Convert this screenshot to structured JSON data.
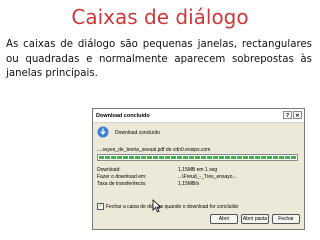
{
  "slide": {
    "title": "Caixas de diálogo",
    "body": "As caixas de diálogo são pequenas janelas, rectangulares ou quadradas e normalmente aparecem sobrepostas às janelas principais."
  },
  "dialog": {
    "title": "Download concluído",
    "heading": "Download concluído",
    "filename": "....ssyes_de_teoria_sexual.pdf de cdn0.ensips.com",
    "progress": 1.0,
    "rows": [
      {
        "label": "Download:",
        "value": "1,15MB em 1 seg"
      },
      {
        "label": "Fazer o download em:",
        "value": "...\\Freud_-_Tres_ensayo..."
      },
      {
        "label": "Taxa de transferência:",
        "value": "1,15MB/s"
      }
    ],
    "checkbox": {
      "label": "Fechar a caixa de diálogo quando o download for concluído",
      "checked": true
    },
    "buttons": {
      "open": "Abrir",
      "open_folder": "Abrir pasta",
      "close": "Fechar"
    },
    "window_buttons": {
      "help": "?",
      "close": "✕"
    }
  },
  "colors": {
    "title": "#c93a3a",
    "dialog_bg": "#ece9d8",
    "progress": "#3fb24a"
  }
}
